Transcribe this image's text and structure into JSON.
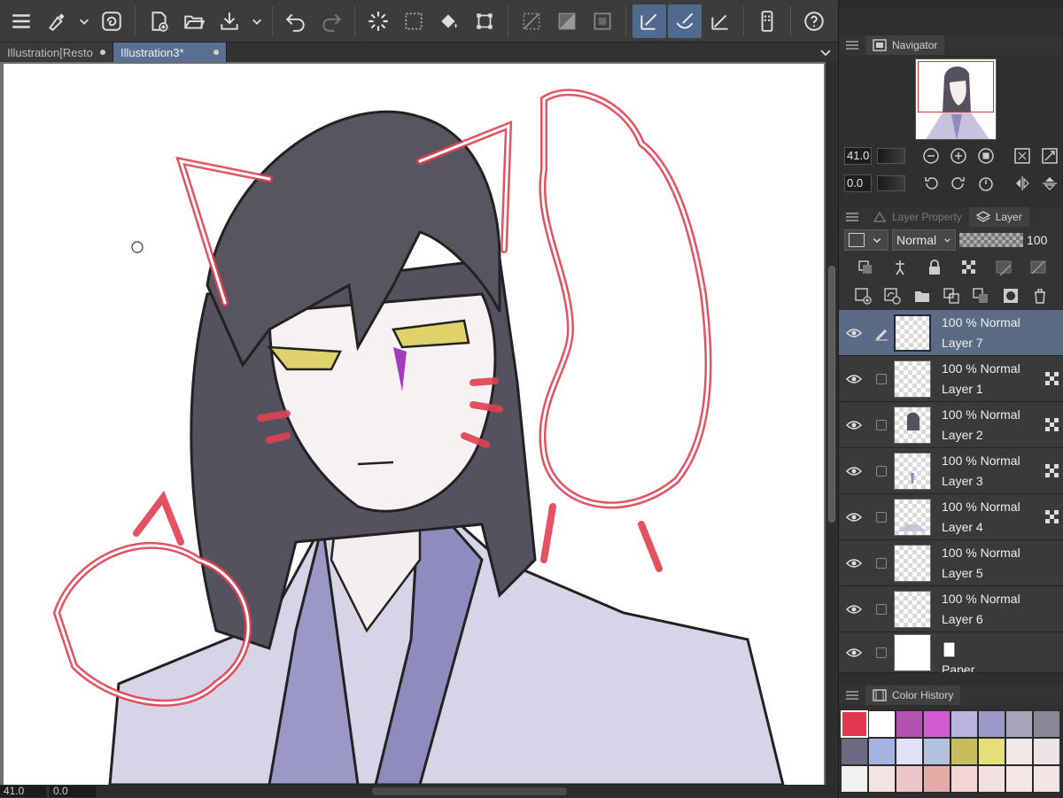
{
  "tabs": [
    {
      "label": "Illustration[Resto",
      "active": false
    },
    {
      "label": "Illustration3*",
      "active": true
    }
  ],
  "statusbar": {
    "zoom": "41.0",
    "rotation": "0.0"
  },
  "navigator": {
    "title": "Navigator",
    "zoom": "41.0",
    "angle": "0.0"
  },
  "layer_panel": {
    "tab_property": "Layer Property",
    "tab_layer": "Layer",
    "blend_mode": "Normal",
    "opacity": "100",
    "layers": [
      {
        "mode": "100 % Normal",
        "name": "Layer 7",
        "selected": true
      },
      {
        "mode": "100 % Normal",
        "name": "Layer 1",
        "selected": false
      },
      {
        "mode": "100 % Normal",
        "name": "Layer 2",
        "selected": false
      },
      {
        "mode": "100 % Normal",
        "name": "Layer 3",
        "selected": false
      },
      {
        "mode": "100 % Normal",
        "name": "Layer 4",
        "selected": false
      },
      {
        "mode": "100 % Normal",
        "name": "Layer 5",
        "selected": false
      },
      {
        "mode": "100 % Normal",
        "name": "Layer 6",
        "selected": false
      },
      {
        "mode": "",
        "name": "Paper",
        "selected": false
      }
    ]
  },
  "color_history": {
    "title": "Color History",
    "colors": [
      "#e0394f",
      "#ffffff",
      "#b353b0",
      "#d45ad4",
      "#b9b5dc",
      "#9b97c6",
      "#a8a4b9",
      "#8a8797",
      "#6b6a80",
      "#a2b4e1",
      "#dee2f2",
      "#b3c3df",
      "#c6bd5e",
      "#e5df7a",
      "#f0e7e7",
      "#ebe3e4",
      "#f3f0f0",
      "#f3e3e3",
      "#ecc6c6",
      "#e8aaa6",
      "#f2d6d6",
      "#f2e0e0",
      "#f6e7e7",
      "#f4e5e5"
    ]
  },
  "colors": {
    "accent": "#52698e",
    "lineart": "#e04050",
    "hair": "#55525f",
    "robe": "#c7c3df"
  }
}
